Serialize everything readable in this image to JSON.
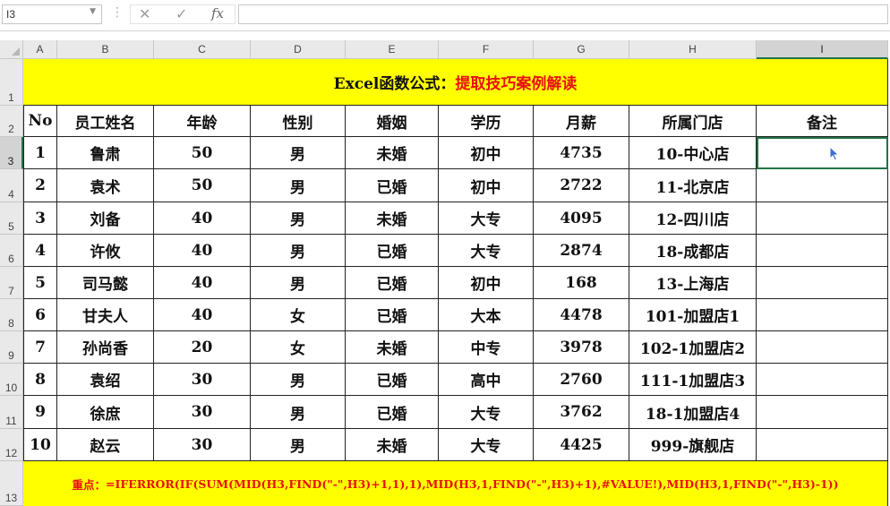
{
  "formula_bar": {
    "name_box": "I3",
    "cancel_icon": "✕",
    "enter_icon": "✓",
    "fx_label": "fx",
    "formula": ""
  },
  "columns": [
    "A",
    "B",
    "C",
    "D",
    "E",
    "F",
    "G",
    "H",
    "I"
  ],
  "rows": [
    "1",
    "2",
    "3",
    "4",
    "5",
    "6",
    "7",
    "8",
    "9",
    "10",
    "11",
    "12",
    "13"
  ],
  "sheet": {
    "title_part1": "Excel函数公式：",
    "title_part2": "提取技巧案例解读",
    "headers": [
      "No",
      "员工姓名",
      "年龄",
      "性别",
      "婚姻",
      "学历",
      "月薪",
      "所属门店",
      "备注"
    ],
    "data": [
      [
        "1",
        "鲁肃",
        "50",
        "男",
        "未婚",
        "初中",
        "4735",
        "10-中心店",
        ""
      ],
      [
        "2",
        "袁术",
        "50",
        "男",
        "已婚",
        "初中",
        "2722",
        "11-北京店",
        ""
      ],
      [
        "3",
        "刘备",
        "40",
        "男",
        "未婚",
        "大专",
        "4095",
        "12-四川店",
        ""
      ],
      [
        "4",
        "许攸",
        "40",
        "男",
        "已婚",
        "大专",
        "2874",
        "18-成都店",
        ""
      ],
      [
        "5",
        "司马懿",
        "40",
        "男",
        "已婚",
        "初中",
        "168",
        "13-上海店",
        ""
      ],
      [
        "6",
        "甘夫人",
        "40",
        "女",
        "已婚",
        "大本",
        "4478",
        "101-加盟店1",
        ""
      ],
      [
        "7",
        "孙尚香",
        "20",
        "女",
        "未婚",
        "中专",
        "3978",
        "102-1加盟店2",
        ""
      ],
      [
        "8",
        "袁绍",
        "30",
        "男",
        "已婚",
        "高中",
        "2760",
        "111-1加盟店3",
        ""
      ],
      [
        "9",
        "徐庶",
        "30",
        "男",
        "已婚",
        "大专",
        "3762",
        "18-1加盟店4",
        ""
      ],
      [
        "10",
        "赵云",
        "30",
        "男",
        "未婚",
        "大专",
        "4425",
        "999-旗舰店",
        ""
      ]
    ],
    "note_label": "重点：",
    "note_formula": "=IFERROR(IF(SUM(MID(H3,FIND(\"-\",H3)+1,1),1),MID(H3,1,FIND(\"-\",H3)+1),#VALUE!),MID(H3,1,FIND(\"-\",H3)-1))"
  },
  "selected_cell": "I3",
  "colors": {
    "highlight": "#ffff00",
    "accent_red": "#e81010",
    "selection": "#217346"
  }
}
